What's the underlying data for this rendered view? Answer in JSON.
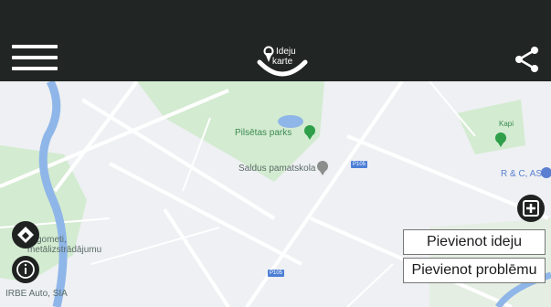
{
  "header": {
    "logo_line1": "Ideju",
    "logo_line2": "karte",
    "menu_icon": "hamburger-icon",
    "share_icon": "share-icon"
  },
  "map": {
    "labels": {
      "park": "Pilsētas parks",
      "school": "Saldus pamatskola",
      "business": "R & C, AS",
      "kapi": "Kapi",
      "ergo1": "Ergometi,",
      "ergo2": "metālizstrādājumu",
      "irbe": "IRBE Auto, SIA"
    },
    "road_badge": "P105"
  },
  "controls": {
    "add_map_icon": "plus-square-icon",
    "navigate_icon": "navigation-diamond-icon",
    "info_icon": "info-icon"
  },
  "actions": {
    "add_idea": "Pievienot ideju",
    "add_problem": "Pievienot problēmu"
  },
  "colors": {
    "header_bg": "#212524",
    "park_green": "#cfe8c9",
    "river_blue": "#8fb6e8",
    "marker_green": "#2f9f4a"
  }
}
